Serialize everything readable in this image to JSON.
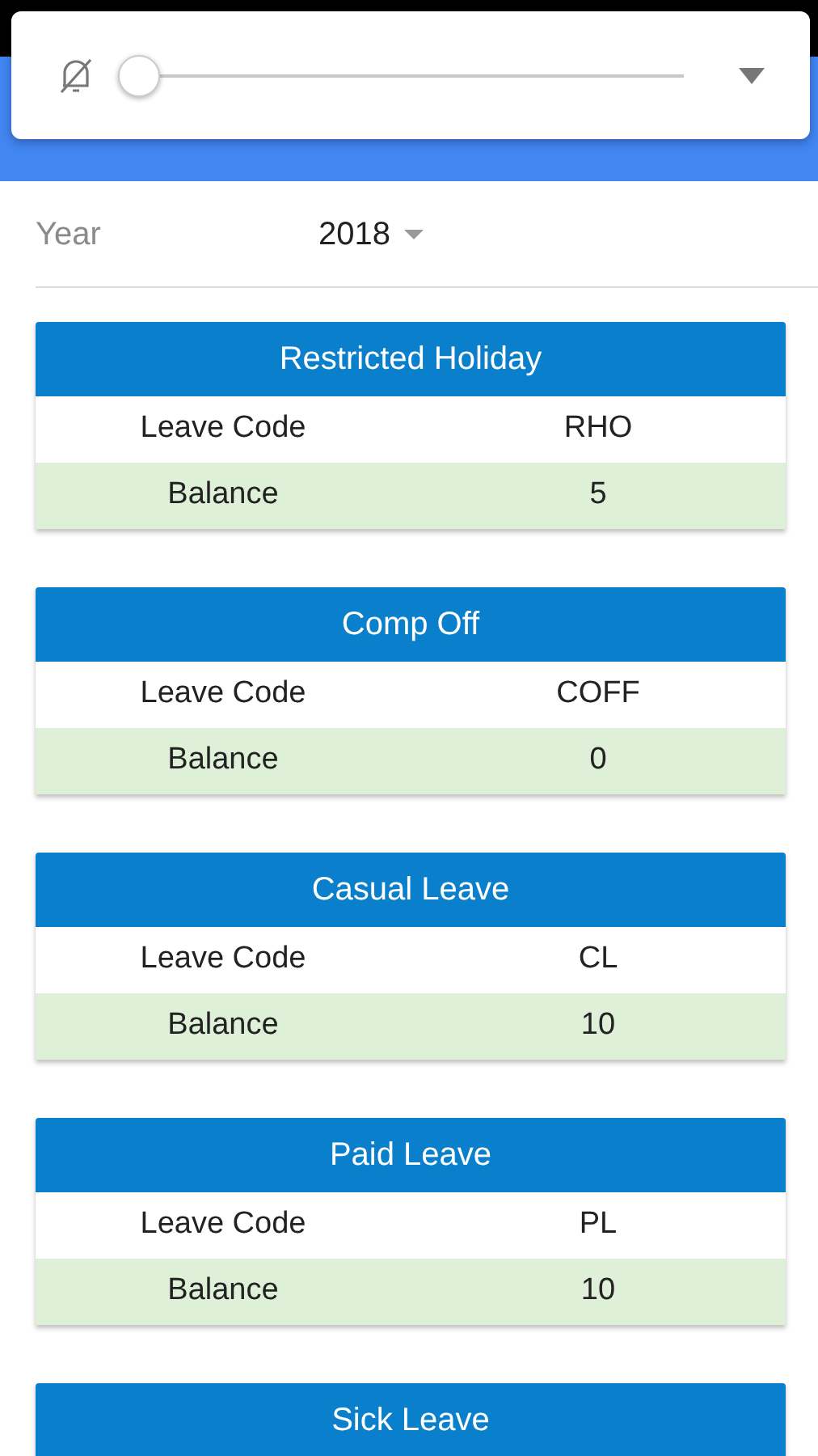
{
  "volume_panel": {
    "level": 0
  },
  "filter": {
    "label": "Year",
    "value": "2018"
  },
  "leave_cards": [
    {
      "title": "Restricted Holiday",
      "rows": [
        {
          "label": "Leave Code",
          "value": "RHO"
        },
        {
          "label": "Balance",
          "value": "5"
        }
      ]
    },
    {
      "title": "Comp Off",
      "rows": [
        {
          "label": "Leave Code",
          "value": "COFF"
        },
        {
          "label": "Balance",
          "value": "0"
        }
      ]
    },
    {
      "title": "Casual Leave",
      "rows": [
        {
          "label": "Leave Code",
          "value": "CL"
        },
        {
          "label": "Balance",
          "value": "10"
        }
      ]
    },
    {
      "title": "Paid Leave",
      "rows": [
        {
          "label": "Leave Code",
          "value": "PL"
        },
        {
          "label": "Balance",
          "value": "10"
        }
      ]
    },
    {
      "title": "Sick Leave"
    }
  ]
}
